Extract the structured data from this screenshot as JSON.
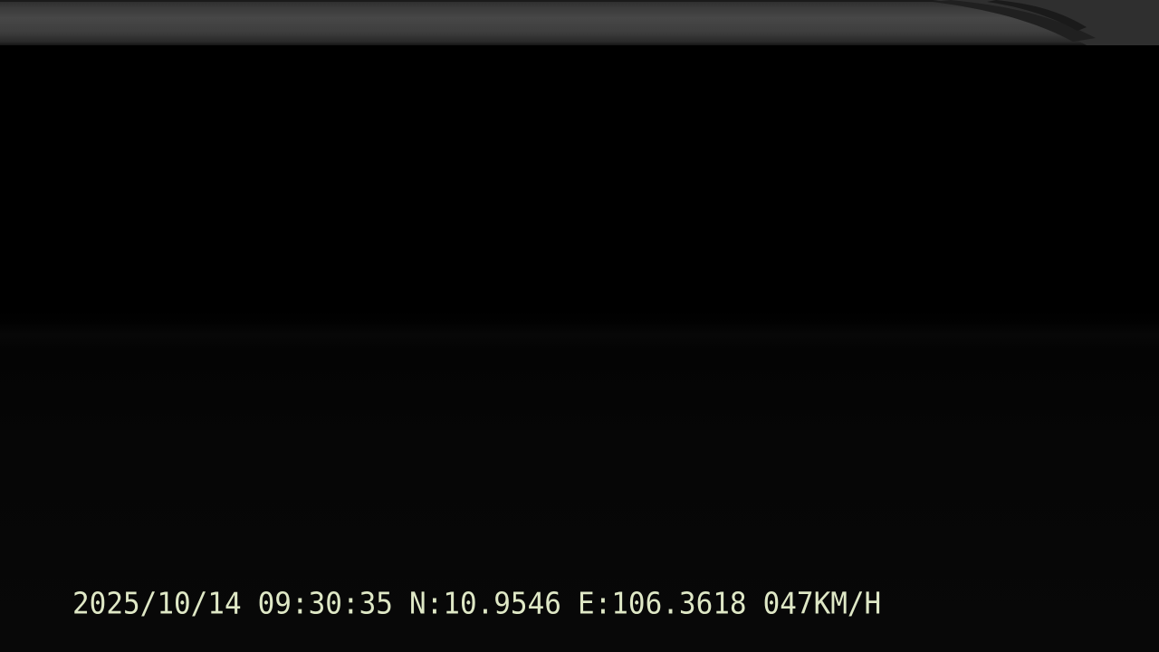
{
  "overlay": {
    "date": "2025/10/14",
    "time": "09:30:35",
    "latitude": "N:10.9546",
    "longitude": "E:106.3618",
    "speed": "047KM/H"
  },
  "colors": {
    "overlay_text": "#dfe8c6",
    "scene_background": "#000000",
    "top_strip": "#454545"
  }
}
